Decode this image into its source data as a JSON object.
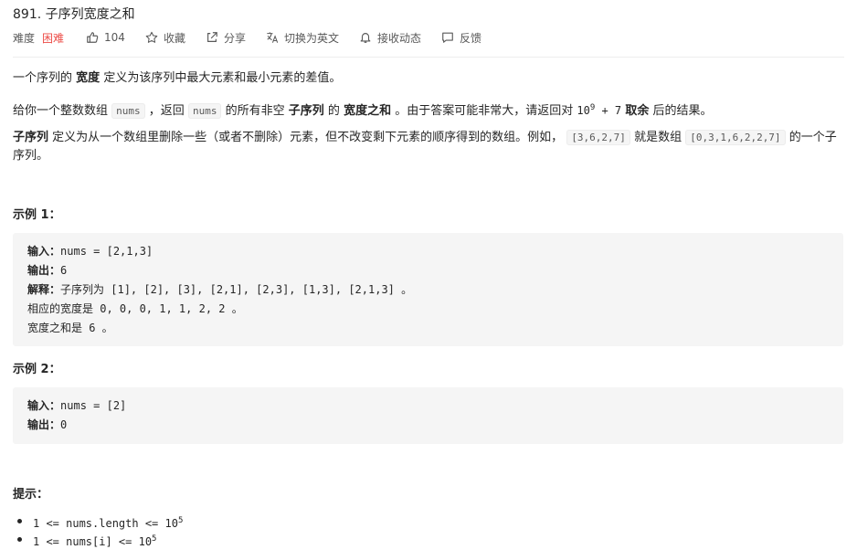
{
  "problem": {
    "title": "891. 子序列宽度之和"
  },
  "meta": {
    "difficulty_label": "难度",
    "difficulty": "困难",
    "likes": "104",
    "favorite": "收藏",
    "share": "分享",
    "translate": "切换为英文",
    "subscribe": "接收动态",
    "feedback": "反馈"
  },
  "desc": {
    "p1_a": "一个序列的",
    "p1_b": "宽度",
    "p1_c": "定义为该序列中最大元素和最小元素的差值。",
    "p2_a": "给你一个整数数组",
    "p2_code1": "nums",
    "p2_b": "，返回",
    "p2_code2": "nums",
    "p2_c": "的所有非空",
    "p2_d": "子序列",
    "p2_e": "的",
    "p2_f": "宽度之和",
    "p2_g": "。由于答案可能非常大，请返回对",
    "p2_mod_base": "10",
    "p2_mod_exp": "9",
    "p2_mod_rest": "+ 7",
    "p2_h": "取余",
    "p2_i": "后的结果。",
    "p3_a": "子序列",
    "p3_b": "定义为从一个数组里删除一些（或者不删除）元素，但不改变剩下元素的顺序得到的数组。例如，",
    "p3_code1": "[3,6,2,7]",
    "p3_c": "就是数组",
    "p3_code2": "[0,3,1,6,2,2,7]",
    "p3_d": "的一个子序列。"
  },
  "example1": {
    "heading": "示例 1：",
    "input_label": "输入：",
    "input": "nums = [2,1,3]",
    "output_label": "输出：",
    "output": "6",
    "explain_label": "解释：",
    "explain1": "子序列为 [1], [2], [3], [2,1], [2,3], [1,3], [2,1,3] 。",
    "explain2": "相应的宽度是 0, 0, 0, 1, 1, 2, 2 。",
    "explain3": "宽度之和是 6 。"
  },
  "example2": {
    "heading": "示例 2：",
    "input_label": "输入：",
    "input": "nums = [2]",
    "output_label": "输出：",
    "output": "0"
  },
  "hints": {
    "heading": "提示：",
    "items": [
      {
        "text": "1 <= nums.length <= 10",
        "exp": "5"
      },
      {
        "text": "1 <= nums[i] <= 10",
        "exp": "5"
      }
    ]
  },
  "colors": {
    "difficulty": "#ec4c47",
    "code_bg": "#f5f5f5"
  }
}
